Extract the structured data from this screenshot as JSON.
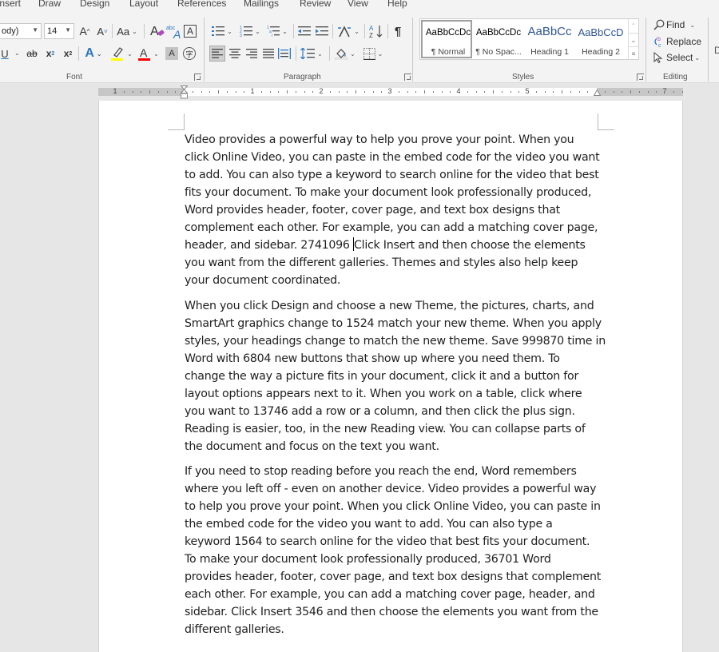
{
  "ribbon": {
    "tabs": [
      "Insert",
      "Draw",
      "Design",
      "Layout",
      "References",
      "Mailings",
      "Review",
      "View",
      "Help"
    ],
    "font": {
      "group_label": "Font",
      "font_name": "(Body)",
      "font_name_visible": "ody)",
      "font_size": "14",
      "grow_font": "A",
      "shrink_font": "A",
      "change_case": "Aa",
      "char_border": "A",
      "underline": "U",
      "strikethrough": "ab",
      "subscript": "x",
      "superscript": "x",
      "text_effects": "A",
      "highlight_color": "#ffff00",
      "font_color": "#ff0000",
      "char_shading": "A",
      "enclose_char": "字"
    },
    "paragraph": {
      "group_label": "Paragraph",
      "show_marks": "¶"
    },
    "styles": {
      "group_label": "Styles",
      "items": [
        {
          "sample": "AaBbCcDc",
          "name": "¶ Normal",
          "selected": true
        },
        {
          "sample": "AaBbCcDc",
          "name": "¶ No Spac...",
          "selected": false
        },
        {
          "sample": "AaBbCc",
          "name": "Heading 1",
          "selected": false
        },
        {
          "sample": "AaBbCcD",
          "name": "Heading 2",
          "selected": false
        }
      ]
    },
    "editing": {
      "group_label": "Editing",
      "find": "Find",
      "replace": "Replace",
      "select": "Select"
    },
    "overflow_letter": "D"
  },
  "ruler": {
    "numbers": [
      "1",
      "1",
      "2",
      "3",
      "4",
      "5",
      "7"
    ]
  },
  "document": {
    "paragraphs": [
      {
        "lines": [
          "Video provides a powerful way to help you prove your point. When you",
          "click Online Video, you can paste in the embed code for the video you want",
          "to add. You can also type a keyword to search online for the video that best",
          "fits your document. To make your document look professionally produced,",
          "Word provides header, footer, cover page, and text box designs that",
          "complement each other. For example, you can add a matching cover page,",
          "header, and sidebar. 2741096 ",
          "Click Insert and then choose the elements",
          "you want from the different galleries. Themes and styles also help keep",
          "your document coordinated."
        ]
      },
      {
        "lines": [
          "When you click Design and choose a new Theme, the pictures, charts, and",
          "SmartArt graphics change to 1524 match your new theme. When you apply",
          "styles, your headings change to match the new theme. Save 999870 time in",
          "Word with 6804 new buttons that show up where you need them. To",
          "change the way a picture fits in your document, click it and a button for",
          "layout options appears next to it. When you work on a table, click where",
          "you want to 13746 add a row or a column, and then click the plus sign.",
          "Reading is easier, too, in the new Reading view. You can collapse parts of",
          "the document and focus on the text you want."
        ]
      },
      {
        "lines": [
          "If you need to stop reading before you reach the end, Word remembers",
          "where you left off - even on another device. Video provides a powerful way",
          "to help you prove your point. When you click Online Video, you can paste in",
          "the embed code for the video you want to add. You can also type a",
          "keyword 1564 to search online for the video that best fits your document.",
          "To make your document look professionally produced, 36701 Word",
          "provides header, footer, cover page, and text box designs that complement",
          "each other. For example, you can add a matching cover page, header, and",
          "sidebar. Click Insert 3546 and then choose the elements you want from the",
          "different galleries."
        ]
      }
    ]
  },
  "colors": {
    "accent_blue": "#2b78c5",
    "heading_blue": "#2f5597",
    "replace_purple": "#b146c2"
  }
}
